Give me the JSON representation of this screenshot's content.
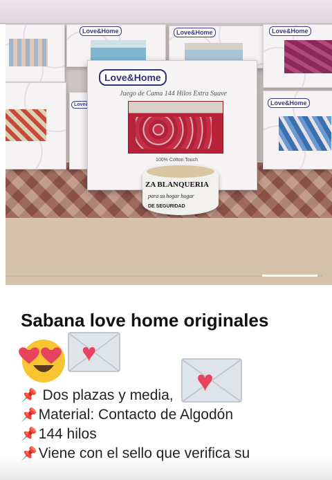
{
  "post": {
    "image": {
      "boxes": [
        {
          "brand": "Love&Home"
        },
        {
          "brand": "Love&Home"
        },
        {
          "brand": "Love&Home"
        },
        {
          "brand": "Love&Home"
        },
        {
          "brand": "Love&Home"
        }
      ],
      "main_box": {
        "brand": "Love&Home",
        "subtitle": "Juego de Cama 144 Hilos Extra Suave",
        "fabric": "100% Cotton Touch"
      },
      "tape": {
        "line1": "ZA BLANQUERIA",
        "line2": "para su hogar hogar",
        "line3": "DE SEGURIDAD"
      },
      "carousel_progress": 0.17
    },
    "title": "Sabana love home originales",
    "emoji": [
      "heart-eyes-face",
      "love-letter",
      "love-letter"
    ],
    "lines": [
      {
        "icon": "pushpin-icon",
        "text": "Dos plazas y media,"
      },
      {
        "icon": "pushpin-icon",
        "text": "Material: Contacto de Algodón"
      },
      {
        "icon": "pushpin-icon",
        "text": "144 hilos"
      },
      {
        "icon": "pushpin-icon",
        "text": "Viene con el sello que verifica su"
      }
    ]
  }
}
